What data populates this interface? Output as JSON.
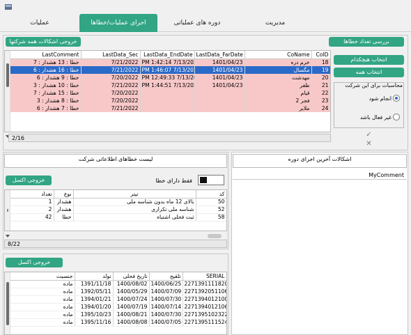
{
  "tabs": [
    "مدیریت",
    "دوره های عملیاتی",
    "اجرای عملیات/خطاها",
    "عملیات"
  ],
  "top": {
    "check_errors_btn": "بررسی تعداد خطاها",
    "export_all_btn": "خروجی اشکالات همه شرکتها",
    "select_none_btn": "انتخاب هیچکدام",
    "select_all_btn": "انتخاب همه",
    "calc_group_label": "محاسبات برای این شرکت",
    "radio_done": "انجام شود",
    "radio_inactive": "غیر فعال باشد",
    "check_glyph": "✓",
    "x_glyph": "✕"
  },
  "companies": {
    "columns": [
      "LastComment",
      "LastData_Sec",
      "LastData_EndDate",
      "LastData_FarDate",
      "CoName",
      "CoID"
    ],
    "rows": [
      {
        "comment": "خطا : 13  هشدار : 7",
        "sec": "7/21/2022",
        "end": "PM 1:42:14 7/13/2022",
        "far": "1401/04/23",
        "name": "خرم دره",
        "id": "18",
        "style": "pink"
      },
      {
        "comment": "خطا : 16  هشدار : 6",
        "sec": "7/21/2022",
        "end": "PM 1:46:07 7/13/2022",
        "far": "1401/04/23",
        "name": "مگسال",
        "id": "19",
        "style": "sel"
      },
      {
        "comment": "خطا : 9  هشدار : 6",
        "sec": "7/20/2022",
        "end": "PM 12:49:33 7/13/2022",
        "far": "1401/04/23",
        "name": "مهدشت",
        "id": "20",
        "style": "pink"
      },
      {
        "comment": "خطا : 10  هشدار : 3",
        "sec": "7/21/2022",
        "end": "PM 1:44:51 7/13/2022",
        "far": "1401/04/23",
        "name": "ظفر",
        "id": "21",
        "style": "pink"
      },
      {
        "comment": "خطا : 15  هشدار : 7",
        "sec": "7/20/2022",
        "end": "",
        "far": "",
        "name": "قیام",
        "id": "22",
        "style": "pink"
      },
      {
        "comment": "خطا : 8  هشدار : 3",
        "sec": "7/20/2022",
        "end": "",
        "far": "",
        "name": "فجر 2",
        "id": "23",
        "style": "pink"
      },
      {
        "comment": "خطا : 7  هشدار : 6",
        "sec": "7/21/2022",
        "end": "",
        "far": "",
        "name": "ملایر",
        "id": "24",
        "style": "pink"
      }
    ],
    "pager": "2/16"
  },
  "errors": {
    "title": "لیست خطاهای اطلاعاتی شرکت",
    "only_errors_label": "فقط دارای خطا",
    "export_btn": "خروجی اکسل",
    "columns": [
      "کد",
      "تیتر",
      "نوع",
      "تعداد"
    ],
    "rows": [
      {
        "code": "50",
        "title": "بالای 12 ماه بدون شناسه ملی",
        "type": "هشدار",
        "count": "1"
      },
      {
        "code": "52",
        "title": "شناسه ملی تکراری",
        "type": "هشدار",
        "count": "2"
      },
      {
        "code": "58",
        "title": "ثبت فحلی اشتباه",
        "type": "خطا",
        "count": "42"
      }
    ],
    "pager": "8/22"
  },
  "recent": {
    "title": "اشکالات آخرین اجرای دوره",
    "column": "MyComment"
  },
  "details": {
    "export_btn": "خروجی اکسل",
    "columns": [
      "SERIAL",
      "تلقیح",
      "تاریخ فحلی",
      "تولد",
      "جنسیت"
    ],
    "rows": [
      {
        "serial": "2271391111820070",
        "insem": "1400/06/25",
        "heat": "1400/08/02",
        "birth": "1391/11/18",
        "sex": "ماده"
      },
      {
        "serial": "2271392051106730",
        "insem": "1400/07/09",
        "heat": "1400/05/29",
        "birth": "1392/05/11",
        "sex": "ماده"
      },
      {
        "serial": "2271394012100930",
        "insem": "1400/07/30",
        "heat": "1400/07/24",
        "birth": "1394/01/21",
        "sex": "ماده"
      },
      {
        "serial": "2271394012106970",
        "insem": "1400/07/14",
        "heat": "1400/07/19",
        "birth": "1394/01/20",
        "sex": "ماده"
      },
      {
        "serial": "2271395102322920",
        "insem": "1400/07/30",
        "heat": "1400/08/21",
        "birth": "1395/10/23",
        "sex": "ماده"
      },
      {
        "serial": "2271395111524750",
        "insem": "1400/07/05",
        "heat": "1400/08/08",
        "birth": "1395/11/16",
        "sex": "ماده"
      }
    ]
  }
}
